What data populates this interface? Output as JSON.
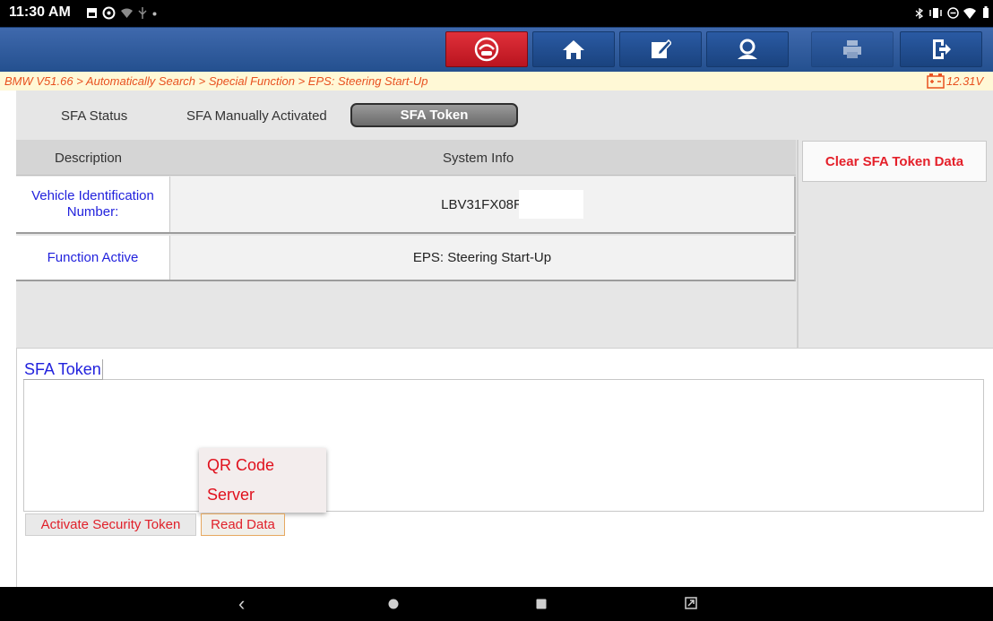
{
  "status_bar": {
    "time": "11:30 AM",
    "left_icons": [
      "gallery-icon",
      "gear-icon",
      "wifi-icon",
      "usb-icon",
      "dot-icon"
    ],
    "right_icons": [
      "bluetooth-icon",
      "vibrate-icon",
      "minus-circle-icon",
      "wifi-icon",
      "battery-icon"
    ]
  },
  "toolbar": {
    "buttons": [
      {
        "name": "dashboard-icon",
        "color": "#e0303a"
      },
      {
        "name": "home-icon",
        "color": "#2a5aa3"
      },
      {
        "name": "edit-icon",
        "color": "#2a5aa3"
      },
      {
        "name": "user-icon",
        "color": "#2a5aa3"
      },
      {
        "name": "print-icon",
        "color": "#2a5aa3"
      },
      {
        "name": "exit-icon",
        "color": "#2a5aa3"
      }
    ]
  },
  "breadcrumb": {
    "path": "BMW V51.66 > Automatically Search > Special Function > EPS: Steering Start-Up",
    "battery": "12.31V"
  },
  "tabs": [
    {
      "label": "SFA Status",
      "active": false
    },
    {
      "label": "SFA Manually Activated",
      "active": false
    },
    {
      "label": "SFA Token",
      "active": true
    }
  ],
  "table": {
    "headers": [
      "Description",
      "System Info"
    ],
    "rows": [
      {
        "label": "Vehicle Identification Number:",
        "value": "LBV31FX08R"
      },
      {
        "label": "Function Active",
        "value": "EPS: Steering Start-Up"
      }
    ]
  },
  "clear_button": "Clear SFA Token Data",
  "token_section": {
    "title": "SFA Token",
    "popup_items": [
      "QR Code",
      "Server"
    ],
    "buttons": [
      "Activate Security Token",
      "Read Data"
    ]
  },
  "nav_bar": {
    "buttons": [
      "back-icon",
      "home-icon",
      "recents-icon",
      "screenshot-icon"
    ],
    "back_glyph": "‹"
  },
  "colors": {
    "accent_red": "#e4202a",
    "link_blue": "#2222dd",
    "breadcrumb_orange": "#e8501f",
    "toolbar_blue": "#2a5aa3"
  }
}
